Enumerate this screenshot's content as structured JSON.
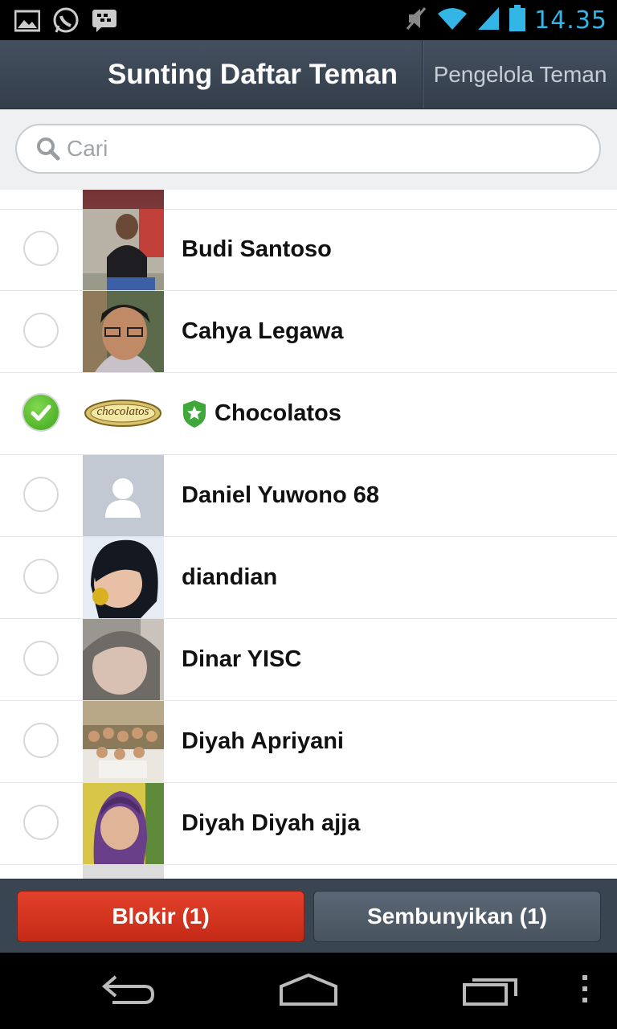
{
  "status_bar": {
    "time": "14.35",
    "icons": [
      "gallery-icon",
      "whatsapp-icon",
      "bbm-icon",
      "mute-icon",
      "wifi-icon",
      "signal-icon",
      "battery-icon"
    ]
  },
  "header": {
    "title": "Sunting Daftar Teman",
    "manage_button": "Pengelola Teman"
  },
  "search": {
    "placeholder": "Cari"
  },
  "friends": [
    {
      "name": "Budi Santoso",
      "checked": false
    },
    {
      "name": "Cahya Legawa",
      "checked": false
    },
    {
      "name": "Chocolatos",
      "checked": true,
      "official": true
    },
    {
      "name": "Daniel Yuwono 68",
      "checked": false
    },
    {
      "name": "diandian",
      "checked": false
    },
    {
      "name": "Dinar YISC",
      "checked": false
    },
    {
      "name": "Diyah Apriyani",
      "checked": false
    },
    {
      "name": "Diyah Diyah ajja",
      "checked": false
    }
  ],
  "avatar_logo_text": "chocolatos",
  "actions": {
    "block": "Blokir (1)",
    "hide": "Sembunyikan (1)"
  },
  "colors": {
    "accent_time": "#33b5e5",
    "header": "#3d4856",
    "block_button": "#d6321e",
    "check_on": "#4cb526"
  }
}
